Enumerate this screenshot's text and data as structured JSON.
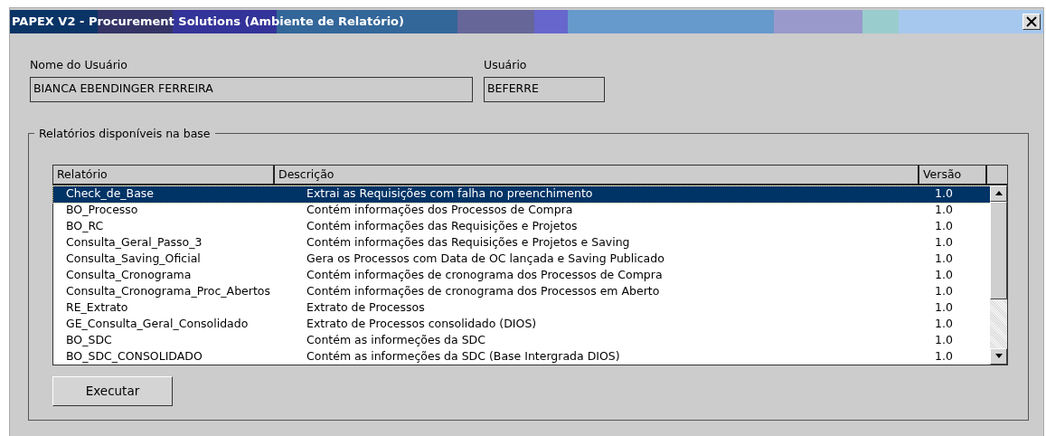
{
  "window": {
    "title": "PAPEX V2 - Procurement Solutions (Ambiente de Relatório)"
  },
  "user_name": {
    "label": "Nome do Usuário",
    "value": "BIANCA EBENDINGER FERREIRA"
  },
  "user": {
    "label": "Usuário",
    "value": "BEFERRE"
  },
  "reports_group": {
    "title": "Relatórios disponíveis na base",
    "table": {
      "columns": [
        "Relatório",
        "Descrição",
        "Versão"
      ],
      "rows": [
        {
          "cells": [
            "Check_de_Base",
            "Extrai as Requisições com falha no preenchimento",
            "1.0"
          ],
          "selected": true
        },
        {
          "cells": [
            "BO_Processo",
            "Contém informações dos Processos de Compra",
            "1.0"
          ],
          "selected": false
        },
        {
          "cells": [
            "BO_RC",
            "Contém informações das Requisições e Projetos",
            "1.0"
          ],
          "selected": false
        },
        {
          "cells": [
            "Consulta_Geral_Passo_3",
            "Contém informações das Requisições e Projetos e Saving",
            "1.0"
          ],
          "selected": false
        },
        {
          "cells": [
            "Consulta_Saving_Oficial",
            "Gera os Processos com Data de OC lançada e Saving Publicado",
            "1.0"
          ],
          "selected": false
        },
        {
          "cells": [
            "Consulta_Cronograma",
            "Contém informações de cronograma dos Processos de Compra",
            "1.0"
          ],
          "selected": false
        },
        {
          "cells": [
            "Consulta_Cronograma_Proc_Abertos",
            "Contém informações de cronograma dos Processos em Aberto",
            "1.0"
          ],
          "selected": false
        },
        {
          "cells": [
            "RE_Extrato",
            "Extrato de Processos",
            "1.0"
          ],
          "selected": false
        },
        {
          "cells": [
            "GE_Consulta_Geral_Consolidado",
            "Extrato de Processos consolidado (DIOS)",
            "1.0"
          ],
          "selected": false
        },
        {
          "cells": [
            "BO_SDC",
            "Contém as informeções da SDC",
            "1.0"
          ],
          "selected": false
        },
        {
          "cells": [
            "BO_SDC_CONSOLIDADO",
            "Contém as informeções da SDC (Base Intergrada DIOS)",
            "1.0"
          ],
          "selected": false
        }
      ]
    }
  },
  "buttons": [
    "Executar"
  ]
}
